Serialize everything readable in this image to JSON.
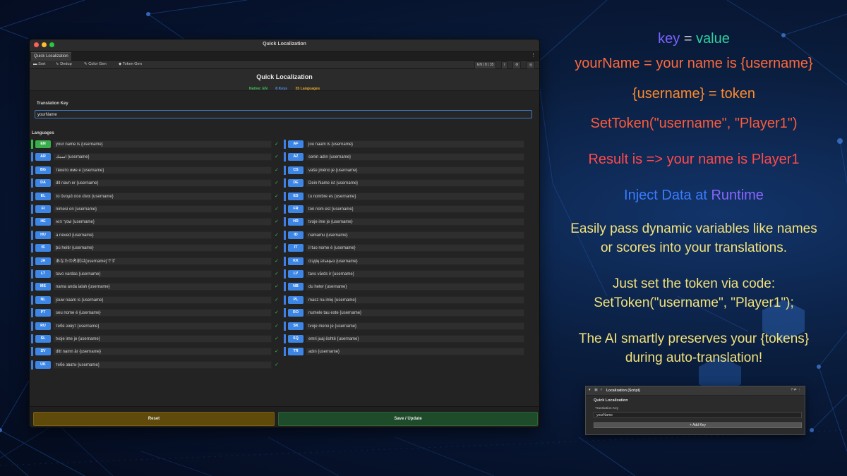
{
  "window": {
    "title": "Quick Localization",
    "tab_label": "Quick Localization",
    "tab_menu": "⋮",
    "toolbar": {
      "sort": "Sort",
      "dedup": "Dedup",
      "color_gen": "Color Gen",
      "token_gen": "Token Gen",
      "lang_counter": "EN | 8 | 35"
    }
  },
  "header": {
    "title": "Quick Localization",
    "native": "Native: EN",
    "keys": "8 Keys",
    "languages": "35 Languages"
  },
  "form": {
    "key_label": "Translation Key",
    "key_value": "yourName",
    "languages_label": "Languages"
  },
  "languages_left": [
    {
      "code": "EN",
      "value": "your name is {username}"
    },
    {
      "code": "AR",
      "value": "اسمك {username}"
    },
    {
      "code": "BG",
      "value": "твоето име е {username}"
    },
    {
      "code": "DA",
      "value": "dit navn er {username}"
    },
    {
      "code": "EL",
      "value": "το όνομά σου είναι {username}"
    },
    {
      "code": "FI",
      "value": "nimesi on {username}"
    },
    {
      "code": "HE",
      "value": "שמך הוא {username}"
    },
    {
      "code": "HU",
      "value": "a neved {username}"
    },
    {
      "code": "IS",
      "value": "þú heitir {username}"
    },
    {
      "code": "JA",
      "value": "あなたの名前は{username}です"
    },
    {
      "code": "LT",
      "value": "tavo vardas {username}"
    },
    {
      "code": "MS",
      "value": "nama anda ialah {username}"
    },
    {
      "code": "NL",
      "value": "jouw naam is {username}"
    },
    {
      "code": "PT",
      "value": "seu nome é {username}"
    },
    {
      "code": "RU",
      "value": "тебя зовут {username}"
    },
    {
      "code": "SL",
      "value": "tvoje ime je {username}"
    },
    {
      "code": "SV",
      "value": "ditt namn är {username}"
    },
    {
      "code": "UK",
      "value": "тебе звати {username}"
    }
  ],
  "languages_right": [
    {
      "code": "AF",
      "value": "jou naam is {username}"
    },
    {
      "code": "AZ",
      "value": "sənin adın {username}"
    },
    {
      "code": "CS",
      "value": "vaše jméno je {username}"
    },
    {
      "code": "DE",
      "value": "Dein Name ist {username}"
    },
    {
      "code": "ES",
      "value": "tu nombre es {username}"
    },
    {
      "code": "FR",
      "value": "ton nom est {username}"
    },
    {
      "code": "HR",
      "value": "tvoje ime je {username}"
    },
    {
      "code": "ID",
      "value": "namamu {username}"
    },
    {
      "code": "IT",
      "value": "il tuo nome è {username}"
    },
    {
      "code": "KK",
      "value": "сіздің атыңыз {username}"
    },
    {
      "code": "LV",
      "value": "tavs vārds ir {username}"
    },
    {
      "code": "NB",
      "value": "du heter {username}"
    },
    {
      "code": "PL",
      "value": "masz na imię {username}"
    },
    {
      "code": "RO",
      "value": "numele tau este {username}"
    },
    {
      "code": "SK",
      "value": "tvoje meno je {username}"
    },
    {
      "code": "SQ",
      "value": "emri juaj është {username}"
    },
    {
      "code": "TR",
      "value": "adın {username}"
    }
  ],
  "buttons": {
    "reset": "Reset",
    "save": "Save / Update"
  },
  "promo": {
    "line1_key": "key",
    "line1_eq": "=",
    "line1_value": "value",
    "line2": "yourName = your name is {username}",
    "line3": "{username} = token",
    "line4": "SetToken(\"username\", \"Player1\")",
    "line5": "Result is => your name is Player1",
    "line6a": "Inject Data at",
    "line6b": "Runtime",
    "line7": "Easily pass dynamic variables like names",
    "line8": "or scores into your translations.",
    "line9": "Just set the token via code:",
    "line10": "SetToken(\"username\", \"Player1\");",
    "line11": "The AI smartly preserves your {tokens}",
    "line12": "during auto-translation!"
  },
  "inspector": {
    "title": "Localization (Script)",
    "heading": "Quick Localization",
    "key_label": "Translation Key",
    "key_value": "yourName",
    "add_button": "+ Add Key"
  },
  "colors": {
    "accent_blue": "#3d86e6",
    "native_green": "#3aad4c",
    "reset": "#5f4a0c",
    "save": "#1e4b29",
    "check": "#38c44c"
  }
}
